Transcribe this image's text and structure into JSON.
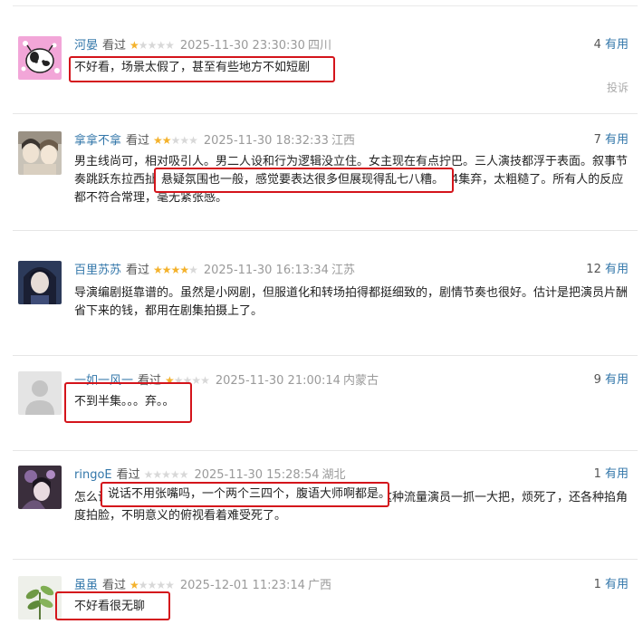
{
  "useful_label": "有用",
  "report_label": "投诉",
  "reviews": [
    {
      "user": "河晏",
      "status": "看过",
      "rating": 1,
      "time": "2025-11-30 23:30:30",
      "location": "四川",
      "useful_count": "4",
      "content": "不好看，场景太假了，甚至有些地方不如短剧",
      "avatar": "cartoon-cow-icon"
    },
    {
      "user": "拿拿不拿",
      "status": "看过",
      "rating": 2,
      "time": "2025-11-30 18:32:33",
      "location": "江西",
      "useful_count": "7",
      "content": "男主线尚可，相对吸引人。男二人设和行为逻辑没立住。女主现在有点拧巴。三人演技都浮于表面。叙事节奏跳跃东拉西扯，悬疑氛围也一般，感觉要表达很多但展现得乱七八糟。4集弃，太粗糙了。所有人的反应都不符合常理，毫无紧张感。",
      "highlight": "悬疑氛围也一般，感觉要表达很多但展现得乱七八糟。",
      "avatar": "anime-characters-icon"
    },
    {
      "user": "百里苏苏",
      "status": "看过",
      "rating": 4,
      "time": "2025-11-30 16:13:34",
      "location": "江苏",
      "useful_count": "12",
      "content": "导演编剧挺靠谱的。虽然是小网剧，但服道化和转场拍得都挺细致的，剧情节奏也很好。估计是把演员片酬省下来的钱，都用在剧集拍摄上了。",
      "avatar": "anime-portrait-icon"
    },
    {
      "user": "一如一风一",
      "status": "看过",
      "rating": 1,
      "time": "2025-11-30 21:00:14",
      "location": "内蒙古",
      "useful_count": "9",
      "content": "不到半集。。。弃。。",
      "avatar": "default-user-icon"
    },
    {
      "user": "ringoE",
      "status": "看过",
      "rating": 0,
      "time": "2025-11-30 15:28:54",
      "location": "湖北",
      "useful_count": "1",
      "content": "怎么说话不用张嘴吗，一个两个三四个，腹语大师啊都是。这种流量演员一抓一大把，烦死了，还各种掐角度拍脸，不明意义的俯视看着难受死了。",
      "highlight": "说话不用张嘴吗，一个两个三四个，腹语大师啊都是。",
      "avatar": "flower-portrait-icon"
    },
    {
      "user": "虽虽",
      "status": "看过",
      "rating": 1,
      "time": "2025-12-01 11:23:14",
      "location": "广西",
      "useful_count": "1",
      "content": "不好看很无聊",
      "avatar": "plant-icon"
    }
  ],
  "colors": {
    "link": "#3377aa",
    "star": "#f4b22c",
    "highlight_border": "#d4141b"
  }
}
